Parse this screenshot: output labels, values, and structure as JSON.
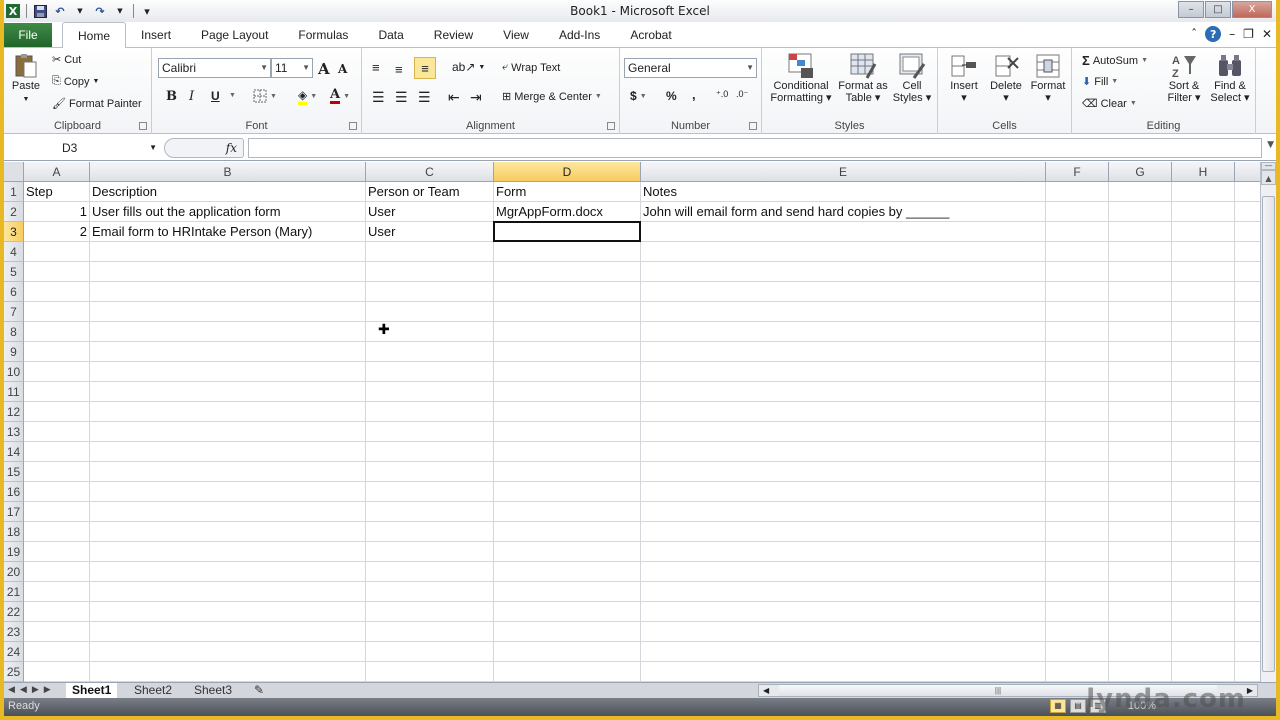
{
  "window": {
    "title": "Book1  -  Microsoft Excel",
    "controls": {
      "minimize": "–",
      "maximize": "□",
      "close": "X"
    }
  },
  "qat": {
    "app_icon": "X",
    "save_icon": "floppy",
    "undo_icon": "↶",
    "redo_icon": "↷",
    "customize_icon": "▾"
  },
  "tabs": [
    {
      "label": "File"
    },
    {
      "label": "Home"
    },
    {
      "label": "Insert"
    },
    {
      "label": "Page Layout"
    },
    {
      "label": "Formulas"
    },
    {
      "label": "Data"
    },
    {
      "label": "Review"
    },
    {
      "label": "View"
    },
    {
      "label": "Add-Ins"
    },
    {
      "label": "Acrobat"
    }
  ],
  "tab_right": {
    "minimize_ribbon": "ˆ",
    "help": "?",
    "wb_min": "–",
    "wb_restore": "❐",
    "wb_close": "✕"
  },
  "ribbon": {
    "clipboard": {
      "label": "Clipboard",
      "paste": "Paste",
      "cut": "Cut",
      "copy": "Copy",
      "format_painter": "Format Painter"
    },
    "font": {
      "label": "Font",
      "font_name": "Calibri",
      "font_size": "11",
      "grow": "A",
      "shrink": "A",
      "bold": "B",
      "italic": "I",
      "underline": "U",
      "fill_color": "#ffff00",
      "font_color": "#c00000"
    },
    "alignment": {
      "label": "Alignment",
      "wrap_text": "Wrap Text",
      "merge_center": "Merge & Center"
    },
    "number": {
      "label": "Number",
      "format": "General",
      "currency": "$",
      "percent": "%",
      "comma": ",",
      "inc_decimal": "←.0 .00",
      "dec_decimal": ".00 →.0"
    },
    "styles": {
      "label": "Styles",
      "conditional": "Conditional Formatting",
      "format_table": "Format as Table",
      "cell_styles": "Cell Styles"
    },
    "cells": {
      "label": "Cells",
      "insert": "Insert",
      "delete": "Delete",
      "format": "Format"
    },
    "editing": {
      "label": "Editing",
      "autosum": "AutoSum",
      "fill": "Fill",
      "clear": "Clear",
      "sort_filter": "Sort & Filter",
      "find_select": "Find & Select"
    }
  },
  "formula_bar": {
    "name_box": "D3",
    "fx": "fx",
    "formula": ""
  },
  "sheet": {
    "columns": [
      "A",
      "B",
      "C",
      "D",
      "E",
      "F",
      "G",
      "H"
    ],
    "selected_column": "D",
    "selected_row": 3,
    "active_cell": "D3",
    "rows": [
      "1",
      "2",
      "3",
      "4",
      "5",
      "6",
      "7",
      "8",
      "9",
      "10",
      "11",
      "12",
      "13",
      "14",
      "15",
      "16",
      "17",
      "18",
      "19",
      "20",
      "21",
      "22",
      "23",
      "24",
      "25"
    ],
    "cells": {
      "A1": "Step",
      "B1": "Description",
      "C1": "Person or Team",
      "D1": "Form",
      "E1": "Notes",
      "A2": "1",
      "B2": "User fills out the application form",
      "C2": "User",
      "D2": "MgrAppForm.docx",
      "E2": "John will email form and send hard copies by ______",
      "A3": "2",
      "B3": "Email form to HRIntake Person (Mary)",
      "C3": "User"
    }
  },
  "sheet_tabs": [
    {
      "label": "Sheet1",
      "active": true
    },
    {
      "label": "Sheet2",
      "active": false
    },
    {
      "label": "Sheet3",
      "active": false
    }
  ],
  "status_bar": {
    "status": "Ready",
    "zoom": "100%",
    "watermark": "lynda.com"
  },
  "colors": {
    "file_tab": "#21652a",
    "selection_header": "#f8cc5f",
    "window_frame": "#e8b923"
  }
}
